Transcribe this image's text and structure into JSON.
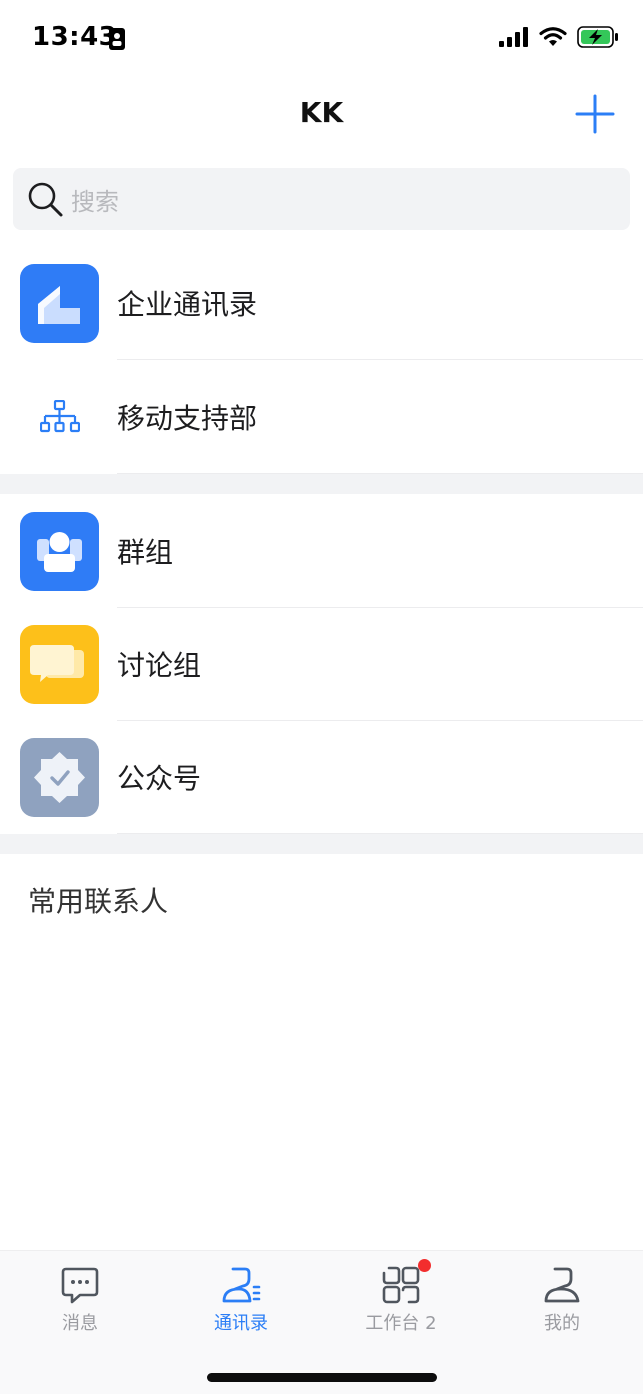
{
  "status_bar": {
    "time": "13:43"
  },
  "header": {
    "title": "KK"
  },
  "search": {
    "placeholder": "搜索"
  },
  "sections": [
    {
      "items": [
        {
          "label": "企业通讯录",
          "icon": "enterprise-directory-icon"
        },
        {
          "label": "移动支持部",
          "icon": "org-chart-icon"
        }
      ]
    },
    {
      "items": [
        {
          "label": "群组",
          "icon": "group-icon"
        },
        {
          "label": "讨论组",
          "icon": "discussion-icon"
        },
        {
          "label": "公众号",
          "icon": "official-account-icon"
        }
      ]
    }
  ],
  "frequent_contacts": {
    "label": "常用联系人"
  },
  "tabs": [
    {
      "label": "消息",
      "icon": "message-icon"
    },
    {
      "label": "通讯录",
      "icon": "contacts-icon",
      "active": true
    },
    {
      "label": "工作台 2",
      "icon": "workbench-icon",
      "badge": true
    },
    {
      "label": "我的",
      "icon": "profile-icon"
    }
  ],
  "colors": {
    "accent": "#2b7ef6",
    "blue_tile": "#2f7cf6",
    "yellow_tile": "#fdc01a",
    "gray_tile": "#8fa2bf",
    "badge": "#f22d2d"
  }
}
